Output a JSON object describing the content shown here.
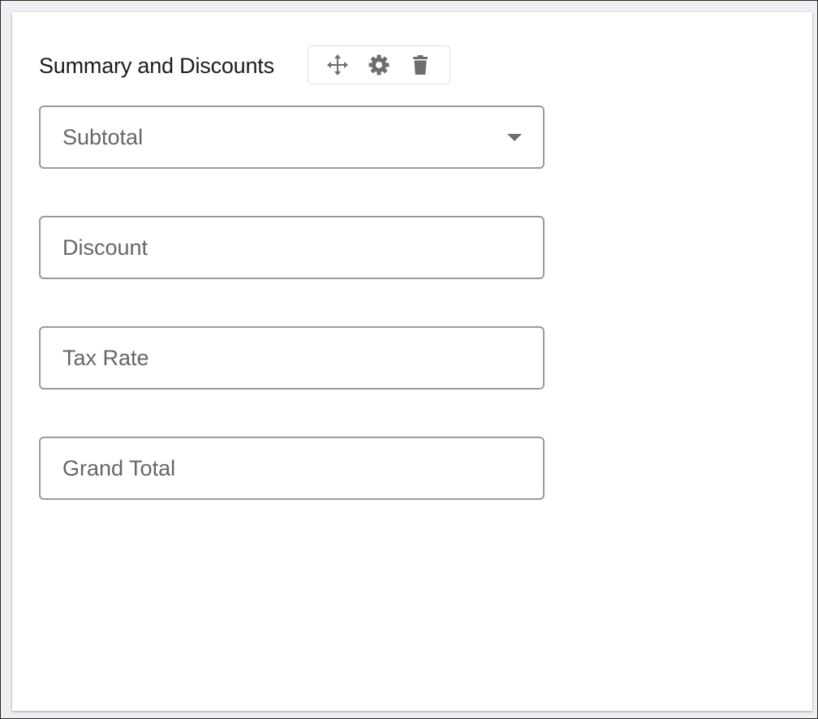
{
  "form": {
    "title": "Summary and Discounts",
    "toolbar": {
      "move_icon": "move-arrows-icon",
      "settings_icon": "gear-icon",
      "delete_icon": "trash-icon"
    },
    "fields": [
      {
        "label": "Subtotal",
        "type": "select"
      },
      {
        "label": "Discount",
        "type": "input"
      },
      {
        "label": "Tax Rate",
        "type": "input"
      },
      {
        "label": "Grand Total",
        "type": "input"
      }
    ]
  },
  "colors": {
    "background": "#edeef2",
    "panel": "#ffffff",
    "field_border": "#9a9a9a",
    "placeholder_text": "#666666",
    "icon": "#6d6d6d"
  }
}
